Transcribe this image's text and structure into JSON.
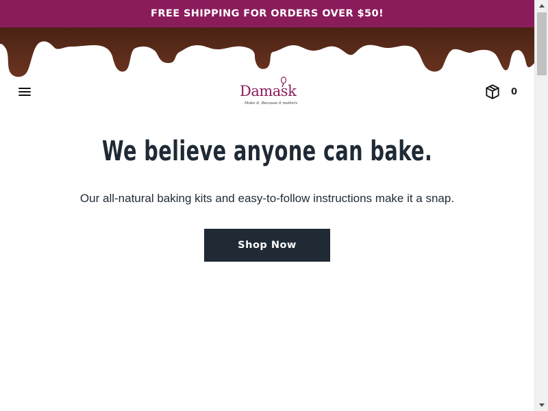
{
  "announcement": {
    "text": "FREE SHIPPING FOR ORDERS OVER $50!"
  },
  "header": {
    "menu_icon": "hamburger-menu-icon",
    "logo": {
      "name": "Damask",
      "tagline": "Make it. Because it matters"
    },
    "cart": {
      "icon": "package-box-icon",
      "count": "0"
    }
  },
  "hero": {
    "title": "We believe anyone can bake.",
    "subtitle": "Our all-natural baking kits and easy-to-follow instructions make it a snap.",
    "cta_label": "Shop Now"
  },
  "colors": {
    "brand": "#8b1c5c",
    "chocolate": "#5a2a18",
    "dark_text": "#1f2a35",
    "button_bg": "#1f2a35"
  }
}
